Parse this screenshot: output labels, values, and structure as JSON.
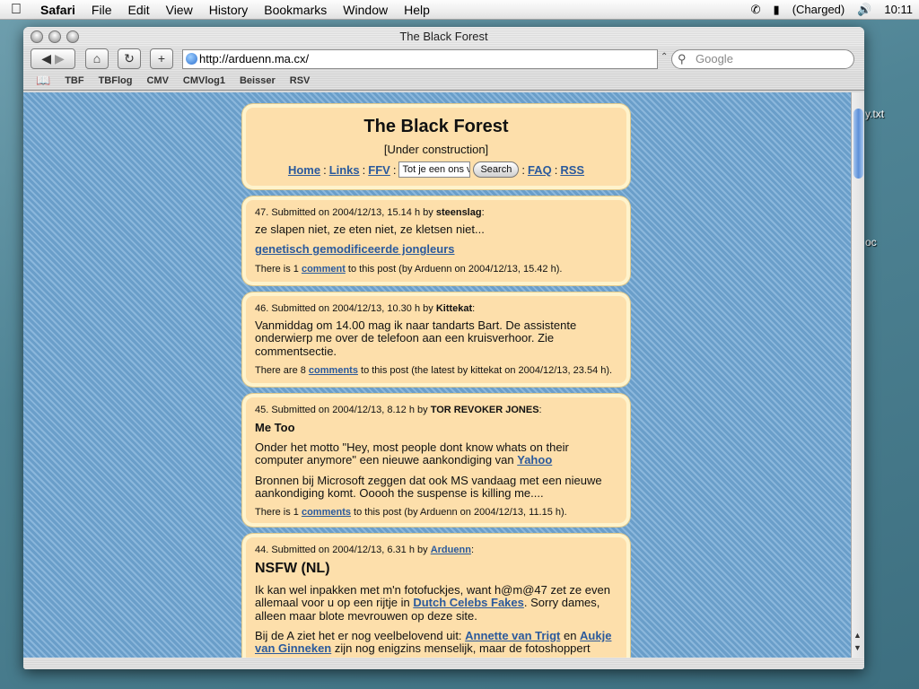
{
  "menubar": {
    "apple": "",
    "items": [
      "Safari",
      "File",
      "Edit",
      "View",
      "History",
      "Bookmarks",
      "Window",
      "Help"
    ],
    "battery": "(Charged)",
    "clock": "10:11"
  },
  "desktop": {
    "label1": "y.txt",
    "label2": "oc"
  },
  "window": {
    "title": "The Black Forest",
    "url": "http://arduenn.ma.cx/",
    "search_placeholder": "Google",
    "bookmarks": [
      "TBF",
      "TBFlog",
      "CMV",
      "CMVlog1",
      "Beisser",
      "RSV"
    ]
  },
  "page": {
    "title": "The Black Forest",
    "subtitle": "[Under construction]",
    "nav": {
      "home": "Home",
      "links": "Links",
      "ffv": "FFV",
      "search_value": "Tot je een ons v",
      "search_button": "Search",
      "faq": "FAQ",
      "rss": "RSS",
      "sep": ":"
    },
    "posts": [
      {
        "meta_prefix": "47. Submitted on 2004/12/13, 15.14 h by ",
        "author": "steenslag",
        "meta_suffix": ":",
        "text1": "ze slapen niet, ze eten niet, ze kletsen niet...",
        "link": "genetisch gemodificeerde jongleurs",
        "foot_prefix": "There is 1 ",
        "foot_link": "comment",
        "foot_suffix": " to this post (by Arduenn on 2004/12/13, 15.42 h)."
      },
      {
        "meta_prefix": "46. Submitted on 2004/12/13, 10.30 h by ",
        "author": "Kittekat",
        "meta_suffix": ":",
        "text1": "Vanmiddag om 14.00 mag ik naar tandarts Bart. De assistente onderwierp me over de telefoon aan een kruisverhoor. Zie commentsectie.",
        "foot_prefix": "There are 8 ",
        "foot_link": "comments",
        "foot_suffix": " to this post (the latest by kittekat on 2004/12/13, 23.54 h)."
      },
      {
        "meta_prefix": "45. Submitted on 2004/12/13, 8.12 h by ",
        "author": "TOR REVOKER JONES",
        "meta_suffix": ":",
        "title": "Me Too",
        "text1": "Onder het motto \"Hey, most people dont know whats on their computer anymore\" een nieuwe aankondiging van ",
        "text1_link": "Yahoo",
        "text2": "Bronnen bij Microsoft zeggen dat ook MS vandaag met een nieuwe aankondiging komt. Ooooh the suspense is killing me....",
        "foot_prefix": "There is 1 ",
        "foot_link": "comments",
        "foot_suffix": " to this post (by Arduenn on 2004/12/13, 11.15 h)."
      },
      {
        "meta_prefix": "44. Submitted on 2004/12/13, 6.31 h by ",
        "author": "Arduenn",
        "meta_suffix": ":",
        "title": "NSFW (NL)",
        "text1": "Ik kan wel inpakken met m'n fotofuckjes, want h@m@47 zet ze even allemaal voor u op een rijtje in ",
        "text1_link": "Dutch Celebs Fakes",
        "text1_after": ". Sorry dames, alleen maar blote mevrouwen op deze site.",
        "text2_prefix": "Bij de A ziet het er nog veelbelovend uit: ",
        "text2_link1": "Annette van Trigt",
        "text2_mid": " en ",
        "text2_link2": "Aukje van Ginneken",
        "text2_after": " zijn nog enigzins menselijk, maar de fotoshoppert"
      }
    ]
  }
}
